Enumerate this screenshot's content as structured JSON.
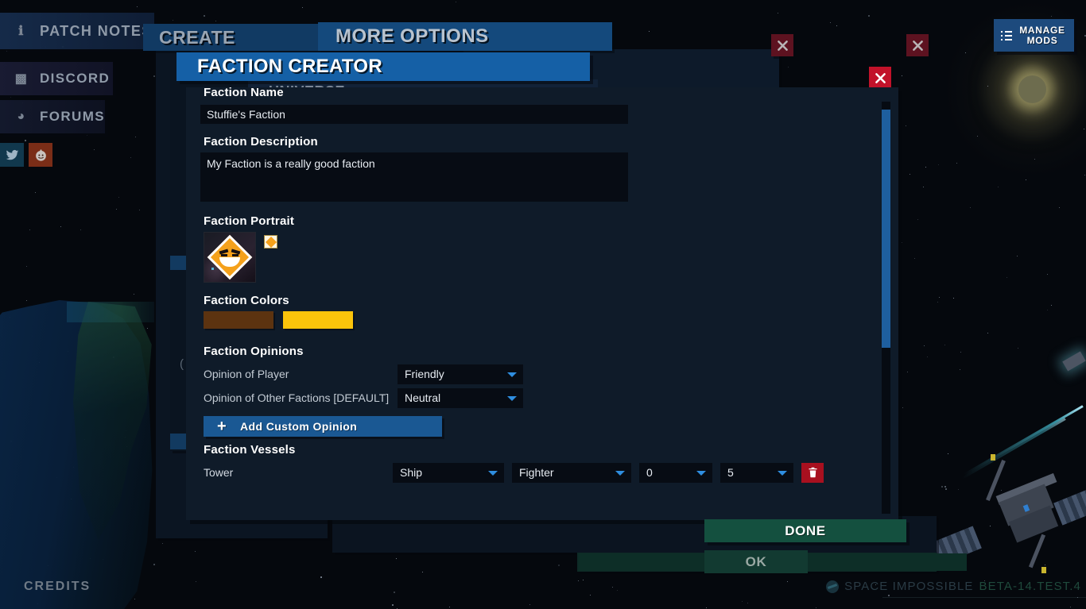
{
  "app": {
    "version_name": "SPACE IMPOSSIBLE",
    "version_build": "BETA-14.TEST.4"
  },
  "left_menu": {
    "items": [
      {
        "label": "PATCH NOTES",
        "icon": "info-icon",
        "glyph": "ℹ"
      },
      {
        "label": "DISCORD",
        "icon": "discord-icon",
        "glyph": "▣"
      },
      {
        "label": "FORUMS",
        "icon": "forums-icon",
        "glyph": "◔"
      }
    ],
    "social": [
      {
        "name": "twitter",
        "color": "#11384d"
      },
      {
        "name": "reddit",
        "color": "#7a2d17"
      }
    ],
    "credits_label": "CREDITS"
  },
  "top_right": {
    "manage_mods_label": "MANAGE\nMODS",
    "manage_mods_line1": "MANAGE",
    "manage_mods_line2": "MODS",
    "icon": "list-icon"
  },
  "windows": {
    "create_title": "CREATE",
    "more_options_title": "MORE OPTIONS",
    "faction_creator_title": "FACTION CREATOR",
    "universe_title": "UNIVERSE",
    "close_label": "✕"
  },
  "form": {
    "faction_name": {
      "label": "Faction Name",
      "value": "Stuffie's Faction"
    },
    "faction_description": {
      "label": "Faction Description",
      "value": "My Faction is a really good faction"
    },
    "faction_portrait": {
      "label": "Faction Portrait",
      "selected_icon": "faction-emblem-diamond"
    },
    "faction_colors": {
      "label": "Faction Colors",
      "primary": "#5C3310",
      "secondary": "#FBC40B"
    },
    "faction_opinions": {
      "label": "Faction Opinions",
      "rows": [
        {
          "label": "Opinion of Player",
          "value": "Friendly"
        },
        {
          "label": "Opinion of Other Factions [DEFAULT]",
          "value": "Neutral"
        }
      ],
      "add_button": {
        "label": "Add Custom Opinion",
        "icon": "plus-icon",
        "glyph": "+"
      }
    },
    "faction_vessels": {
      "label": "Faction Vessels",
      "rows": [
        {
          "name": "Tower",
          "type": "Ship",
          "class": "Fighter",
          "min": "0",
          "max": "5",
          "delete_icon": "trash-icon"
        }
      ]
    }
  },
  "footer": {
    "done_label": "DONE",
    "ok_label": "OK"
  },
  "theme": {
    "accent_blue": "#1560a6",
    "dropdown_caret": "#2f8ee0",
    "danger_red": "#c2122a",
    "green_confirm": "#14503f"
  }
}
